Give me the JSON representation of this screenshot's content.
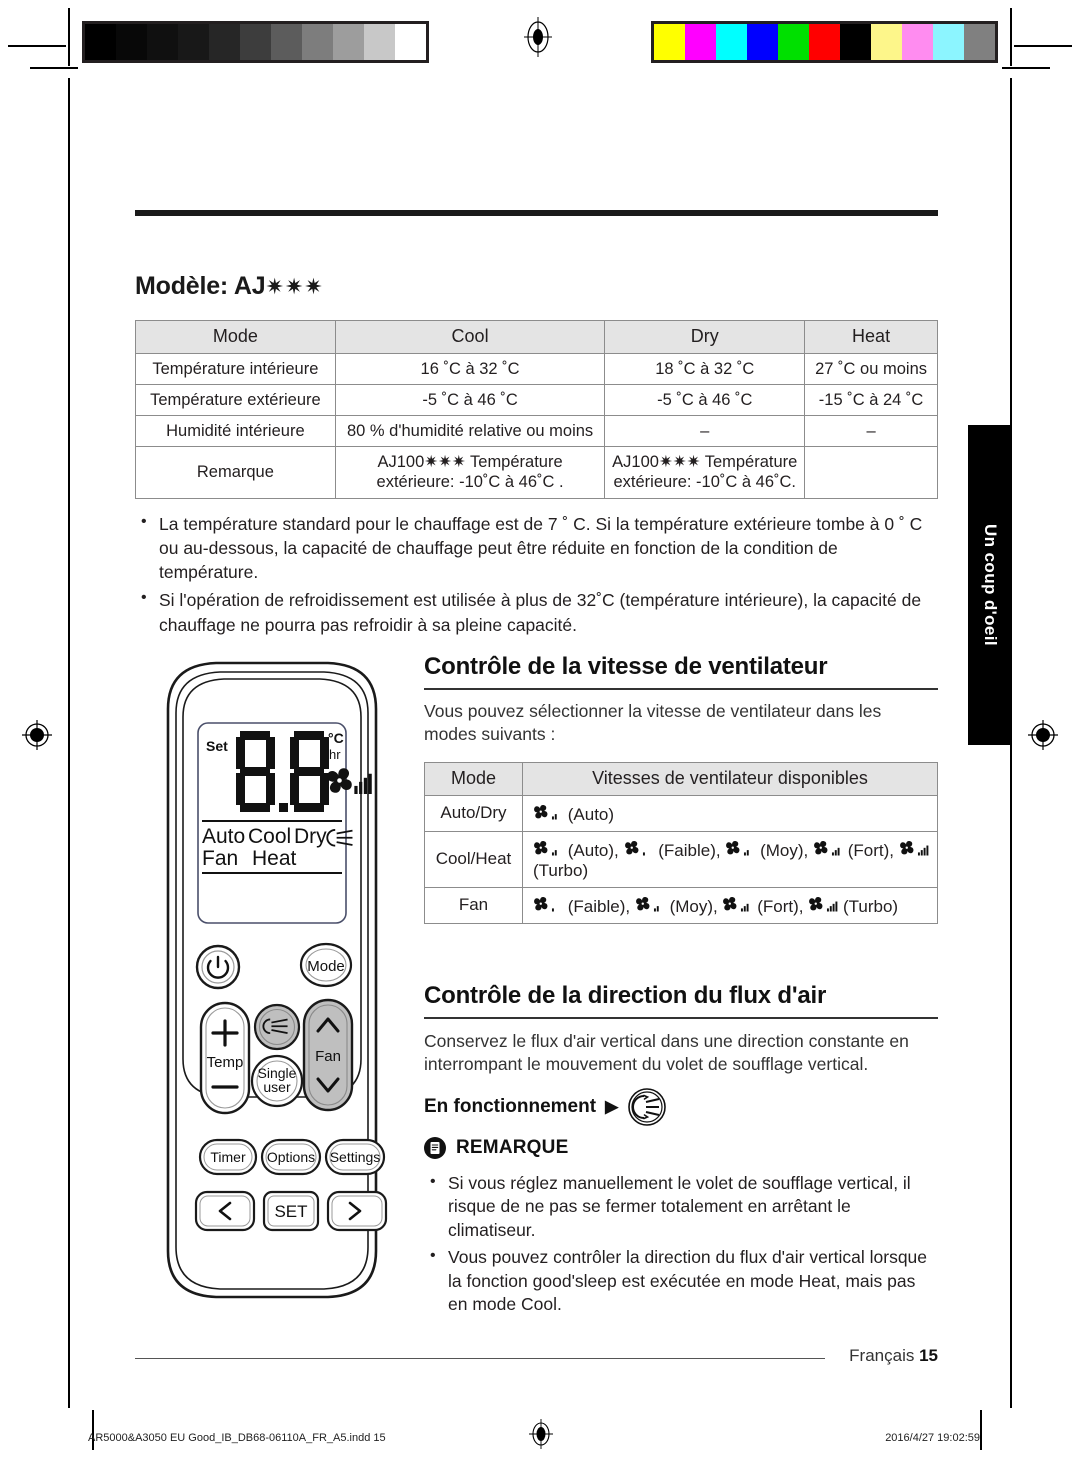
{
  "print": {
    "grayscale_bar": [
      "#000000",
      "#080808",
      "#101010",
      "#181818",
      "#262626",
      "#3d3d3d",
      "#5c5c5c",
      "#7d7d7d",
      "#9d9d9d",
      "#c8c8c8",
      "#ffffff"
    ],
    "color_bar": [
      "#ffff00",
      "#ff00ff",
      "#00ffff",
      "#0000ff",
      "#00e000",
      "#ff0000",
      "#000000",
      "#fdf68a",
      "#ff8cf0",
      "#8cf5ff",
      "#808080"
    ],
    "slug_left": "AR5000&A3050 EU Good_IB_DB68-06110A_FR_A5.indd   15",
    "slug_right": "2016/4/27   19:02:59"
  },
  "side_tab": {
    "label": "Un coup d'oeil"
  },
  "model": {
    "title": "Modèle: AJ",
    "stars": "✷✷✷"
  },
  "spec_table": {
    "headers": [
      "Mode",
      "Cool",
      "Dry",
      "Heat"
    ],
    "rows": [
      {
        "label": "Température intérieure",
        "cells": [
          "16 ˚C à 32 ˚C",
          "18 ˚C à 32 ˚C",
          "27 ˚C ou moins"
        ]
      },
      {
        "label": "Température extérieure",
        "cells": [
          "-5 ˚C à 46 ˚C",
          "-5 ˚C à 46 ˚C",
          "-15 ˚C à 24 ˚C"
        ]
      },
      {
        "label": "Humidité intérieure",
        "cells": [
          "80 % d'humidité relative ou moins",
          "–",
          "–"
        ]
      },
      {
        "label": "Remarque",
        "cells": [
          "AJ100✷✷✷ Température extérieure: -10˚C à 46˚C .",
          "AJ100✷✷✷ Température extérieure: -10˚C à 46˚C.",
          ""
        ]
      }
    ]
  },
  "bullets_top": [
    "La température standard pour le chauffage est de 7 ˚ C. Si la température extérieure tombe à 0 ˚ C ou au-dessous, la capacité de chauffage peut être réduite en fonction de la condition de température.",
    "Si l'opération de refroidissement est utilisée à plus de 32˚C (température intérieure), la capacité de chauffage ne pourra pas refroidir à sa pleine capacité."
  ],
  "fan_section": {
    "heading": "Contrôle de la vitesse de ventilateur",
    "paragraph": "Vous pouvez sélectionner la vitesse de ventilateur dans les modes suivants :",
    "table": {
      "headers": [
        "Mode",
        "Vitesses de ventilateur disponibles"
      ],
      "rows": [
        {
          "mode": "Auto/Dry",
          "speeds": [
            {
              "level": 2,
              "label": "(Auto)"
            }
          ]
        },
        {
          "mode": "Cool/Heat",
          "speeds": [
            {
              "level": 2,
              "label": "(Auto),"
            },
            {
              "level": 1,
              "label": "(Faible),"
            },
            {
              "level": 2,
              "label": "(Moy),"
            },
            {
              "level": 3,
              "label": "(Fort),"
            },
            {
              "level": 4,
              "label": "(Turbo)"
            }
          ]
        },
        {
          "mode": "Fan",
          "speeds": [
            {
              "level": 1,
              "label": "(Faible),"
            },
            {
              "level": 2,
              "label": "(Moy),"
            },
            {
              "level": 3,
              "label": "(Fort),"
            },
            {
              "level": 4,
              "label": "(Turbo)"
            }
          ]
        }
      ]
    }
  },
  "air_section": {
    "heading": "Contrôle de la direction du flux d'air",
    "paragraph": "Conservez le flux d'air vertical dans une direction constante en interrompant le mouvement du volet de soufflage vertical.",
    "operation_label": "En fonctionnement",
    "operation_arrow": "▶"
  },
  "note": {
    "title": "REMARQUE",
    "bullets": [
      "Si vous réglez manuellement le volet de soufflage vertical, il risque de ne pas se fermer totalement en arrêtant le climatiseur.",
      "Vous pouvez contrôler la direction du flux d'air vertical lorsque la fonction good'sleep est exécutée en mode Heat, mais pas en mode Cool."
    ]
  },
  "remote": {
    "display": {
      "set": "Set",
      "unit_c": "°C",
      "unit_hr": "hr",
      "digits": "8.8",
      "modes_row1": [
        "Auto",
        "Cool",
        "Dry"
      ],
      "modes_row2": [
        "Fan",
        "Heat"
      ]
    },
    "buttons": {
      "power": "⏻",
      "mode": "Mode",
      "temp": "Temp",
      "temp_plus": "+",
      "temp_minus": "−",
      "single_user": "Single user",
      "fan": "Fan",
      "timer": "Timer",
      "options": "Options",
      "settings": "Settings",
      "set": "SET",
      "left": "‹",
      "right": "›"
    }
  },
  "footer": {
    "language": "Français",
    "page": "15"
  }
}
